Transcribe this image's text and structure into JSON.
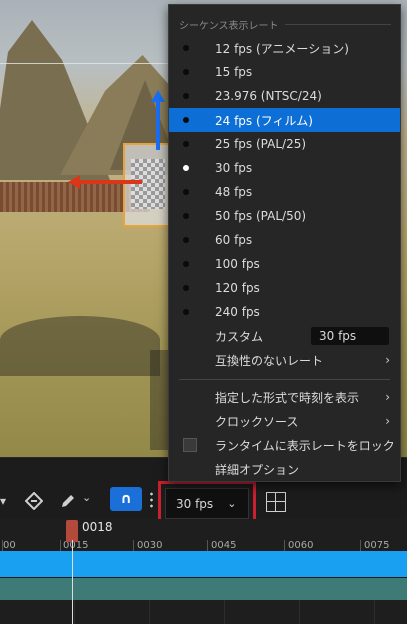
{
  "menu": {
    "section_title": "シーケンス表示レート",
    "rates": [
      {
        "label": "12 fps (アニメーション)",
        "state": "dot"
      },
      {
        "label": "15 fps",
        "state": "dot"
      },
      {
        "label": "23.976 (NTSC/24)",
        "state": "dot"
      },
      {
        "label": "24 fps (フィルム)",
        "state": "highlighted"
      },
      {
        "label": "25 fps (PAL/25)",
        "state": "dot"
      },
      {
        "label": "30 fps",
        "state": "selected"
      },
      {
        "label": "48 fps",
        "state": "dot"
      },
      {
        "label": "50 fps (PAL/50)",
        "state": "dot"
      },
      {
        "label": "60 fps",
        "state": "dot"
      },
      {
        "label": "100 fps",
        "state": "dot"
      },
      {
        "label": "120 fps",
        "state": "dot"
      },
      {
        "label": "240 fps",
        "state": "dot"
      }
    ],
    "custom_label": "カスタム",
    "custom_value": "30 fps",
    "incompatible_label": "互換性のないレート",
    "display_time_label": "指定した形式で時刻を表示",
    "clock_source_label": "クロックソース",
    "lock_runtime_label": "ランタイムに表示レートをロック",
    "advanced_label": "詳細オプション"
  },
  "toolbar": {
    "fps_value": "30 fps",
    "magnet_glyph": "∩"
  },
  "timeline": {
    "current_frame": "0018",
    "ticks": [
      "00",
      "0015",
      "0030",
      "0045",
      "0060",
      "0075"
    ]
  },
  "colors": {
    "accent": "#0d6fd6",
    "highlight_box": "#cc1f2f",
    "track_primary": "#1aa0f0",
    "track_secondary": "#3e7a76",
    "playhead": "#b44a3b"
  }
}
